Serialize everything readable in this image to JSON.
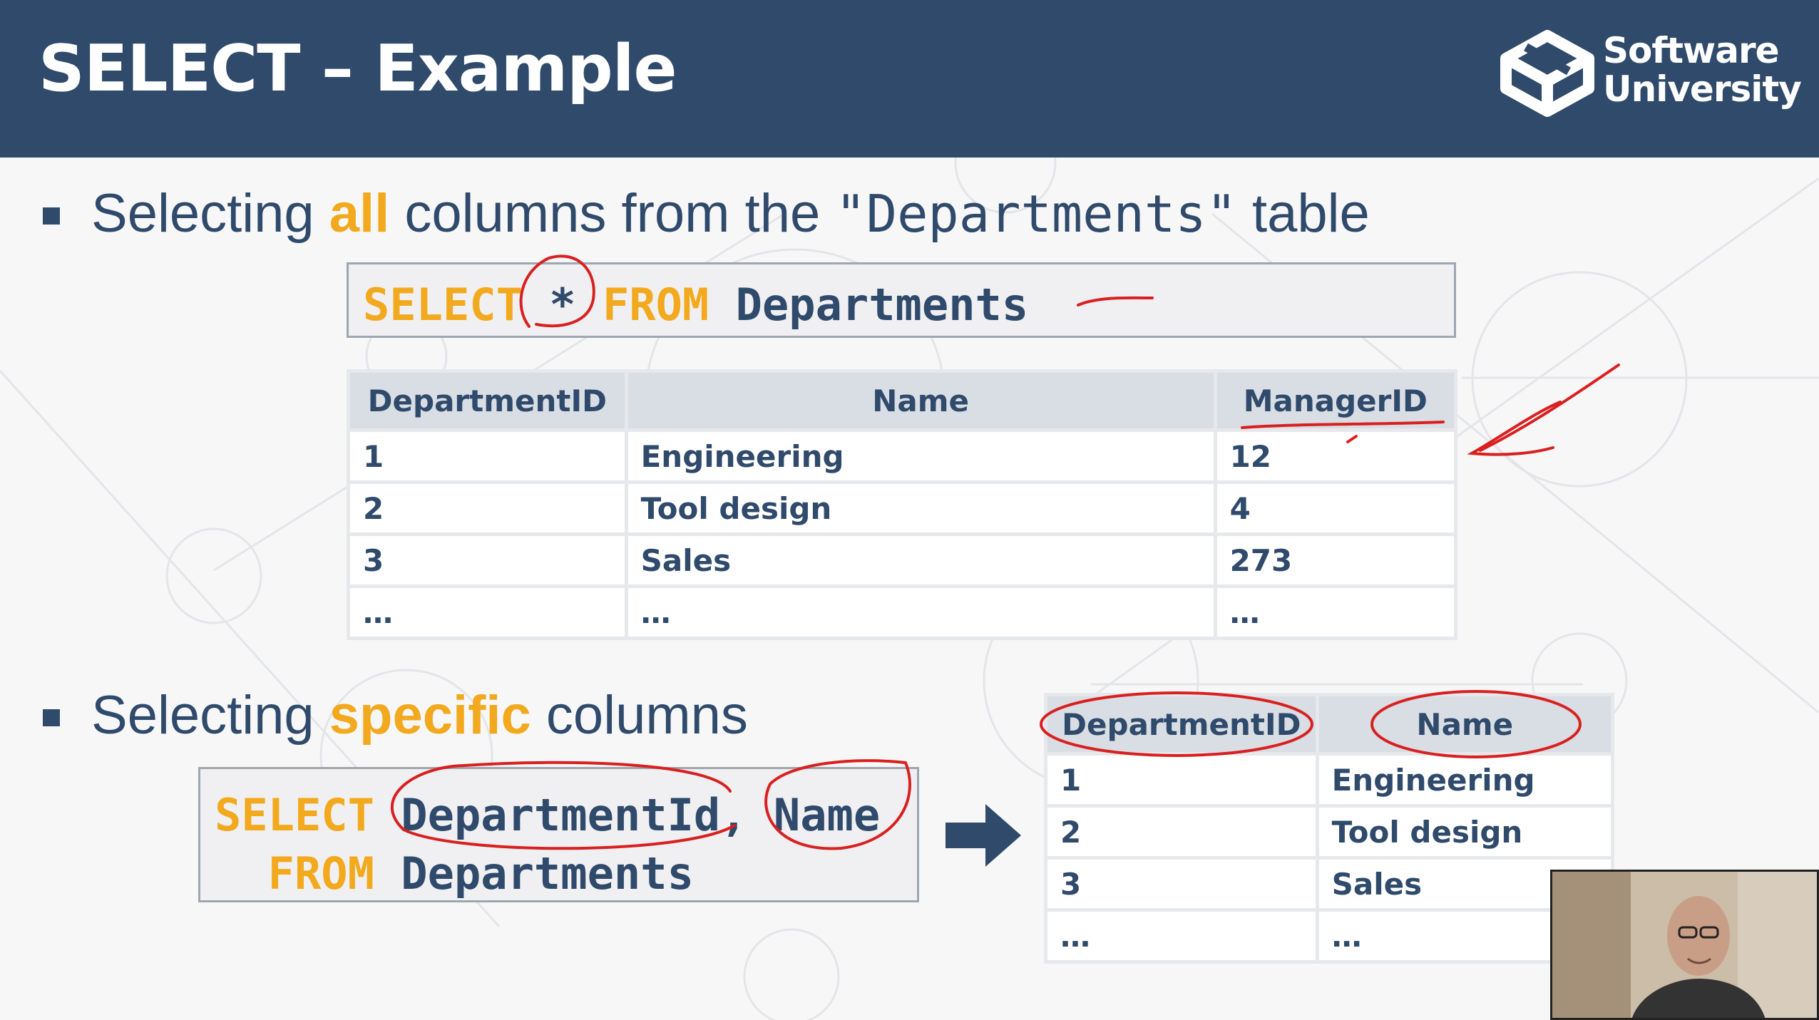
{
  "slide": {
    "title": "SELECT – Example",
    "logo": {
      "line1": "Software",
      "line2": "University"
    }
  },
  "bullets": [
    {
      "before": "Selecting ",
      "highlight": "all",
      "middle": " columns from the ",
      "code": "\"Departments\"",
      "after": " table"
    },
    {
      "before": "Selecting ",
      "highlight": "specific",
      "after": " columns"
    }
  ],
  "query1": {
    "select_kw": "SELECT",
    "star": " * ",
    "from_kw": "FROM",
    "table": " Departments"
  },
  "query2": {
    "select_kw": "SELECT",
    "columns": " DepartmentId, Name",
    "indent": "  ",
    "from_kw": "FROM",
    "table": " Departments"
  },
  "table1": {
    "headers": [
      "DepartmentID",
      "Name",
      "ManagerID"
    ],
    "rows": [
      [
        "1",
        "Engineering",
        "12"
      ],
      [
        "2",
        "Tool design",
        "4"
      ],
      [
        "3",
        "Sales",
        "273"
      ],
      [
        "…",
        "…",
        "…"
      ]
    ]
  },
  "table2": {
    "headers": [
      "DepartmentID",
      "Name"
    ],
    "rows": [
      [
        "1",
        "Engineering"
      ],
      [
        "2",
        "Tool design"
      ],
      [
        "3",
        "Sales"
      ],
      [
        "…",
        "…"
      ]
    ]
  },
  "icons": {
    "bullet": "square-bullet-icon",
    "arrow": "right-arrow-icon",
    "logo": "software-university-logo-icon"
  },
  "colors": {
    "header_bg": "#2f4a6b",
    "accent": "#f3a91e",
    "text": "#2f4a6b",
    "annotation": "#d92020"
  }
}
